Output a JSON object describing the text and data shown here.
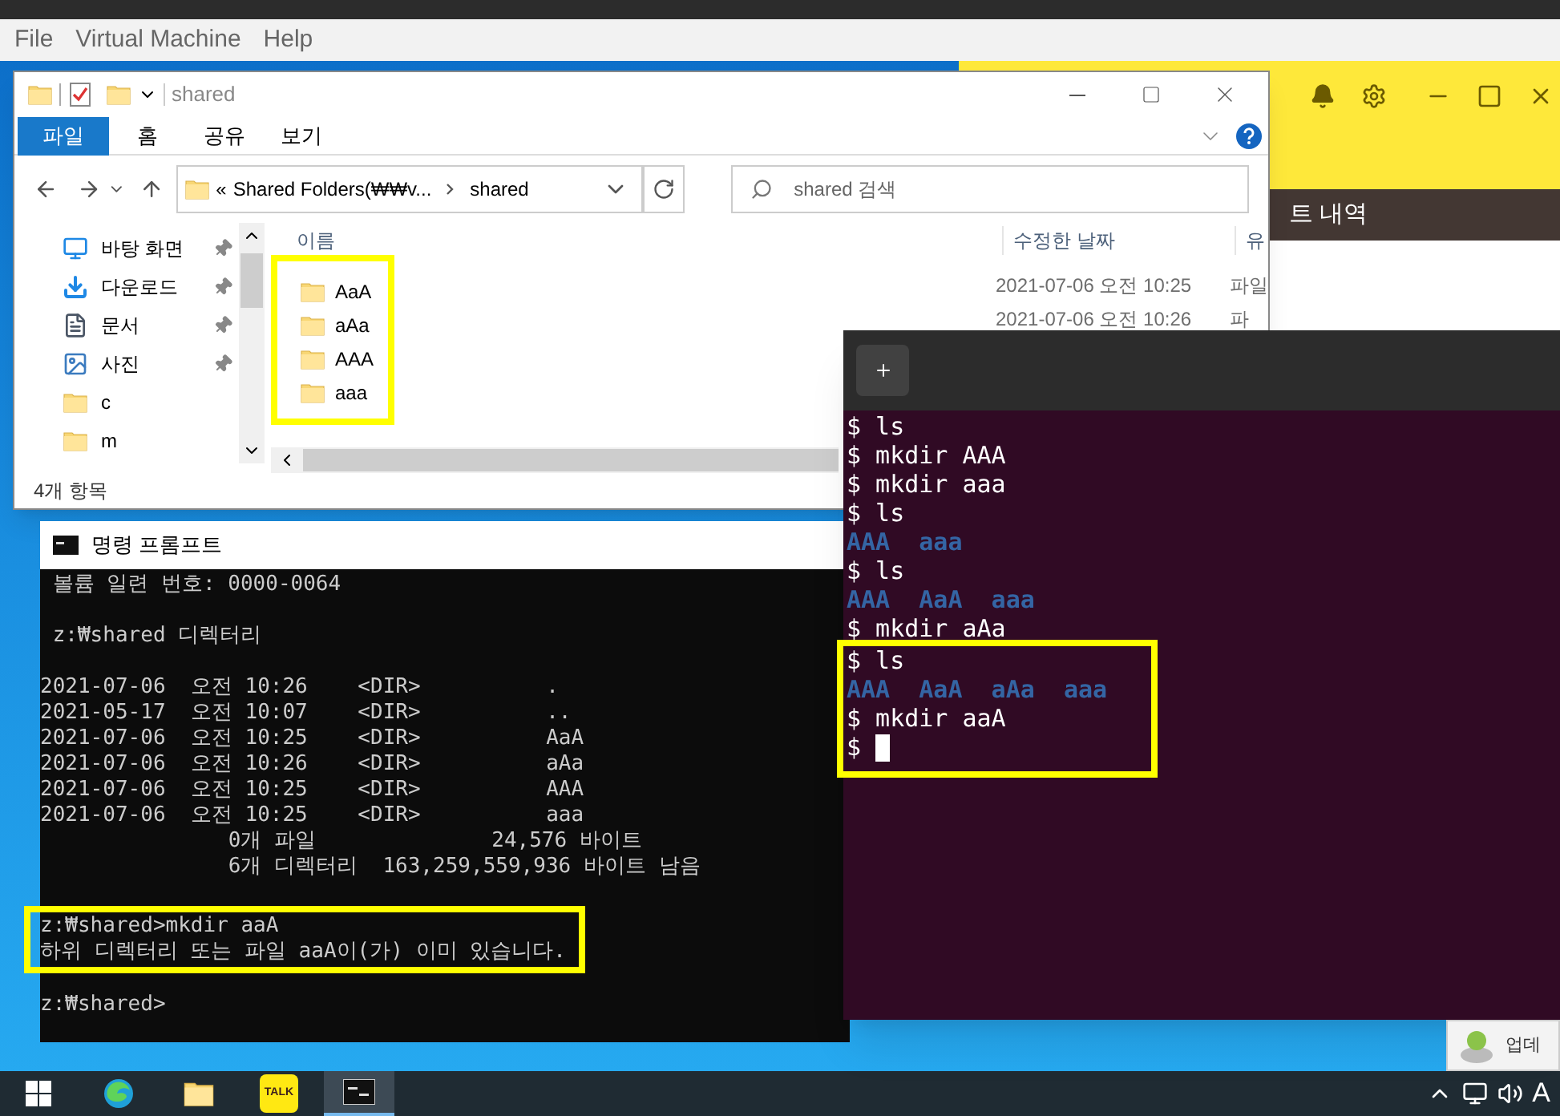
{
  "menu_bar": [
    {
      "label": "File"
    },
    {
      "label": "Virtual Machine"
    },
    {
      "label": "Help"
    }
  ],
  "kakao": {
    "tab_label": "트 내역"
  },
  "explorer": {
    "title": "shared",
    "ribbon_tabs": [
      {
        "label": "파일",
        "selected": true
      },
      {
        "label": "홈",
        "selected": false
      },
      {
        "label": "공유",
        "selected": false
      },
      {
        "label": "보기",
        "selected": false
      }
    ],
    "address": {
      "prefix": "«",
      "parent": "Shared Folders(₩₩v...",
      "current": "shared"
    },
    "search": {
      "placeholder": "shared 검색"
    },
    "nav_items": [
      {
        "label": "바탕 화면",
        "kind": "desktop",
        "pinned": true
      },
      {
        "label": "다운로드",
        "kind": "download",
        "pinned": true
      },
      {
        "label": "문서",
        "kind": "document",
        "pinned": true
      },
      {
        "label": "사진",
        "kind": "picture",
        "pinned": true
      },
      {
        "label": "c",
        "kind": "folder",
        "pinned": false
      },
      {
        "label": "m",
        "kind": "folder",
        "pinned": false
      }
    ],
    "columns": [
      "이름",
      "수정한 날짜",
      "유"
    ],
    "files_highlighted": true,
    "files": [
      {
        "name": "AaA",
        "modified": "2021-07-06 오전 10:25",
        "type": "파일"
      },
      {
        "name": "aAa",
        "modified": "2021-07-06 오전 10:26",
        "type": "파"
      },
      {
        "name": "AAA"
      },
      {
        "name": "aaa"
      }
    ],
    "status": "4개 항목"
  },
  "cmd": {
    "title": "명령 프롬프트",
    "groups": [
      {
        "highlighted": false,
        "lines": [
          " 볼륨 일련 번호: 0000-0064"
        ]
      },
      {
        "highlighted": false,
        "lines": [
          " z:₩shared 디렉터리"
        ]
      },
      {
        "highlighted": false,
        "lines": [
          "2021-07-06  오전 10:26    <DIR>          .",
          "2021-05-17  오전 10:07    <DIR>          ..",
          "2021-07-06  오전 10:25    <DIR>          AaA",
          "2021-07-06  오전 10:26    <DIR>          aAa",
          "2021-07-06  오전 10:25    <DIR>          AAA",
          "2021-07-06  오전 10:25    <DIR>          aaa",
          "               0개 파일              24,576 바이트",
          "               6개 디렉터리  163,259,559,936 바이트 남음"
        ]
      },
      {
        "highlighted": true,
        "lines": [
          "z:₩shared>mkdir aaA",
          "하위 디렉터리 또는 파일 aaA이(가) 이미 있습니다."
        ]
      },
      {
        "highlighted": false,
        "lines": [
          "z:₩shared>"
        ]
      }
    ]
  },
  "terminal": {
    "cursor": true,
    "groups": [
      {
        "highlighted": false,
        "lines": [
          {
            "kind": "prompt",
            "text": "$ ls"
          },
          {
            "kind": "prompt",
            "text": "$ mkdir AAA"
          },
          {
            "kind": "prompt",
            "text": "$ mkdir aaa"
          },
          {
            "kind": "prompt",
            "text": "$ ls"
          },
          {
            "kind": "output",
            "text": "AAA  aaa"
          },
          {
            "kind": "prompt",
            "text": "$ ls"
          },
          {
            "kind": "output",
            "text": "AAA  AaA  aaa"
          },
          {
            "kind": "prompt",
            "text": "$ mkdir aAa"
          }
        ]
      },
      {
        "highlighted": true,
        "lines": [
          {
            "kind": "prompt",
            "text": "$ ls"
          },
          {
            "kind": "output",
            "text": "AAA  AaA  aAa  aaa"
          },
          {
            "kind": "prompt",
            "text": "$ mkdir aaA"
          },
          {
            "kind": "prompt",
            "text": "$"
          }
        ]
      }
    ]
  },
  "notification": {
    "text": "업데"
  },
  "taskbar": {
    "items": [
      {
        "kind": "start",
        "selected": false
      },
      {
        "kind": "edge",
        "selected": false
      },
      {
        "kind": "explorer",
        "selected": false
      },
      {
        "kind": "kakao",
        "label": "TALK",
        "selected": false
      },
      {
        "kind": "cmd",
        "selected": true
      }
    ],
    "ime": "A"
  }
}
